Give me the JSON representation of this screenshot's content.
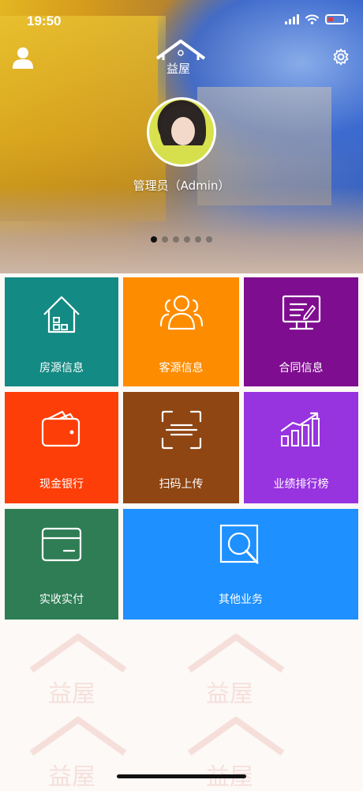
{
  "status": {
    "time": "19:50"
  },
  "header": {
    "logo_text": "益屋",
    "user_name": "管理员（Admin）"
  },
  "carousel": {
    "count": 6,
    "active_index": 0
  },
  "tiles": [
    {
      "label": "房源信息",
      "color": "#138a83",
      "icon": "house-icon"
    },
    {
      "label": "客源信息",
      "color": "#fe8c00",
      "icon": "people-icon"
    },
    {
      "label": "合同信息",
      "color": "#7f0d90",
      "icon": "contract-monitor-icon"
    },
    {
      "label": "现金银行",
      "color": "#fe3e08",
      "icon": "wallet-icon"
    },
    {
      "label": "扫码上传",
      "color": "#8f4613",
      "icon": "scan-icon"
    },
    {
      "label": "业绩排行榜",
      "color": "#9833e0",
      "icon": "growth-chart-icon"
    },
    {
      "label": "实收实付",
      "color": "#2e7d55",
      "icon": "card-icon"
    },
    {
      "label": "其他业务",
      "color": "#1e90ff",
      "icon": "search-icon"
    }
  ]
}
